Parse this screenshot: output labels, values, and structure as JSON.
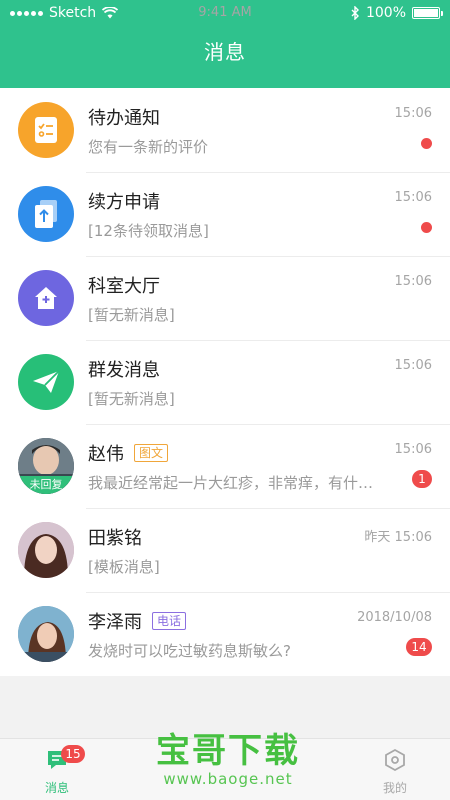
{
  "status_bar": {
    "carrier": "Sketch",
    "time": "9:41 AM",
    "battery": "100%",
    "battery_level": 1.0
  },
  "header": {
    "title": "消息"
  },
  "messages": [
    {
      "name": "待办通知",
      "preview": "您有一条新的评价",
      "time": "15:06",
      "indicator": "dot",
      "avatar_color": "#f7a42b",
      "avatar_icon": "clipboard-icon"
    },
    {
      "name": "续方申请",
      "preview": "[12条待领取消息]",
      "time": "15:06",
      "indicator": "dot",
      "avatar_color": "#2f8dea",
      "avatar_icon": "document-upload-icon"
    },
    {
      "name": "科室大厅",
      "preview": "[暂无新消息]",
      "time": "15:06",
      "avatar_color": "#6e66e0",
      "avatar_icon": "house-plus-icon"
    },
    {
      "name": "群发消息",
      "preview": "[暂无新消息]",
      "time": "15:06",
      "avatar_color": "#27bf78",
      "avatar_icon": "paper-plane-icon"
    },
    {
      "name": "赵伟",
      "tag": "图文",
      "tag_color": "#f0a63a",
      "preview": "我最近经常起一片大红疹，非常痒，有什么办法",
      "time": "15:06",
      "badge": "1",
      "avatar_label": "未回复",
      "avatar_icon": "user-photo"
    },
    {
      "name": "田紫铭",
      "preview": "[模板消息]",
      "time": "昨天 15:06",
      "avatar_icon": "user-photo"
    },
    {
      "name": "李泽雨",
      "tag": "电话",
      "tag_color": "#8b6fe0",
      "preview": "发烧时可以吃过敏药息斯敏么?",
      "time": "2018/10/08",
      "badge": "14",
      "avatar_icon": "user-photo"
    }
  ],
  "tabbar": {
    "tabs": [
      {
        "label": "消息",
        "icon": "chat-icon",
        "badge": "15",
        "active": true,
        "color": "#2fbf7a"
      },
      {
        "label": "我的",
        "icon": "hexagon-icon",
        "active": false,
        "color": "#a8a8a8"
      }
    ]
  },
  "watermark": {
    "cn": "宝哥下载",
    "en": "www.baoge.net"
  }
}
